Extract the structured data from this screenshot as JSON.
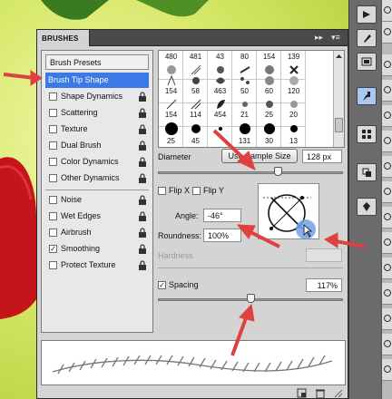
{
  "panel": {
    "tab_label": "BRUSHES",
    "collapse_glyph": "▸▸",
    "menu_glyph": "▾≡"
  },
  "left_list": {
    "presets_label": "Brush Presets",
    "items": [
      {
        "label": "Brush Tip Shape",
        "selected": true,
        "checkbox": false,
        "locked": false
      },
      {
        "label": "Shape Dynamics",
        "checked": false,
        "locked": true
      },
      {
        "label": "Scattering",
        "checked": false,
        "locked": true
      },
      {
        "label": "Texture",
        "checked": false,
        "locked": true
      },
      {
        "label": "Dual Brush",
        "checked": false,
        "locked": true
      },
      {
        "label": "Color Dynamics",
        "checked": false,
        "locked": true
      },
      {
        "label": "Other Dynamics",
        "checked": false,
        "locked": true
      },
      {
        "label": "Noise",
        "checked": false,
        "locked": true
      },
      {
        "label": "Wet Edges",
        "checked": false,
        "locked": true
      },
      {
        "label": "Airbrush",
        "checked": false,
        "locked": true
      },
      {
        "label": "Smoothing",
        "checked": true,
        "locked": true
      },
      {
        "label": "Protect Texture",
        "checked": false,
        "locked": true
      }
    ]
  },
  "brush_tips": {
    "row1": [
      "480",
      "481",
      "43",
      "80",
      "154",
      "139"
    ],
    "row2": [
      "154",
      "58",
      "463",
      "50",
      "60",
      "120"
    ],
    "row3": [
      "154",
      "114",
      "454",
      "21",
      "25",
      "20"
    ],
    "row4": [
      "25",
      "45",
      "",
      "131",
      "30",
      "13"
    ]
  },
  "diameter": {
    "label": "Diameter",
    "use_sample_label": "Use Sample Size",
    "value": "128 px",
    "slider_fraction": 0.65
  },
  "flip": {
    "flip_x_label": "Flip X",
    "flip_y_label": "Flip Y"
  },
  "angle": {
    "label": "Angle:",
    "value": "-46°"
  },
  "roundness": {
    "label": "Roundness:",
    "value": "100%"
  },
  "hardness": {
    "label": "Hardness"
  },
  "spacing": {
    "label": "Spacing",
    "checked": true,
    "value": "117%",
    "slider_fraction": 0.5
  },
  "colors": {
    "accent": "#3b7ae6",
    "arrow": "#e04040",
    "panel_bg": "#d4d4d4"
  }
}
